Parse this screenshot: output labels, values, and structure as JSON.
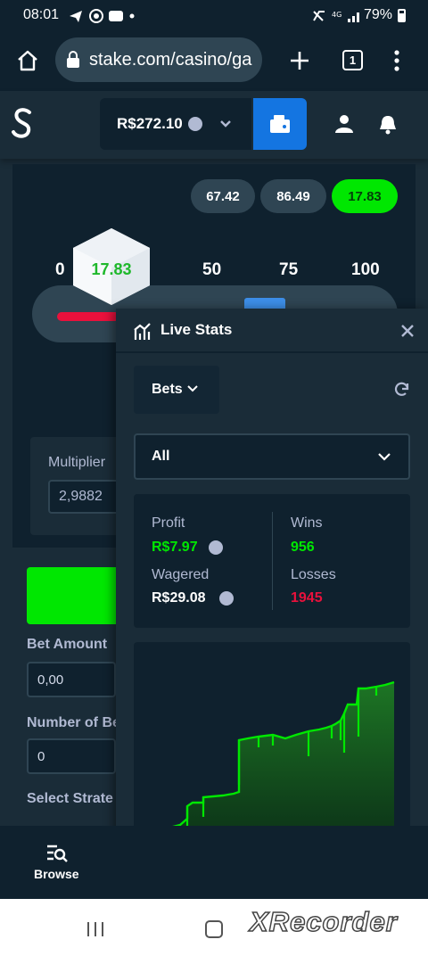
{
  "status": {
    "time": "08:01",
    "battery": "79%",
    "network": "4G"
  },
  "browser": {
    "url": "stake.com/casino/ga",
    "tab_count": "1"
  },
  "header": {
    "balance": "R$272.10"
  },
  "game": {
    "recent_results": [
      "67.42",
      "86.49",
      "17.83"
    ],
    "scale_ticks": [
      "0",
      "50",
      "75",
      "100"
    ],
    "cube_value": "17.83",
    "roll_value": 17.83,
    "multiplier_label": "Multiplier",
    "multiplier_value": "2,9882"
  },
  "left_panel": {
    "bet_amount_label": "Bet Amount",
    "bet_amount_value": "0,00",
    "number_of_bets_label": "Number of Be",
    "number_of_bets_value": "0",
    "select_strategy_label": "Select Strate"
  },
  "live_stats": {
    "title": "Live Stats",
    "bets_dropdown": "Bets",
    "filter_value": "All",
    "profit_label": "Profit",
    "profit_value": "R$7.97",
    "wins_label": "Wins",
    "wins_value": "956",
    "wagered_label": "Wagered",
    "wagered_value": "R$29.08",
    "losses_label": "Losses",
    "losses_value": "1945"
  },
  "nav": {
    "browse": "Browse"
  },
  "watermark": "XRecorder",
  "colors": {
    "green": "#00e701",
    "red": "#e9113c",
    "blue": "#1475e1",
    "bg": "#1a2c38",
    "dark": "#0f212e",
    "grey": "#2f4553"
  }
}
